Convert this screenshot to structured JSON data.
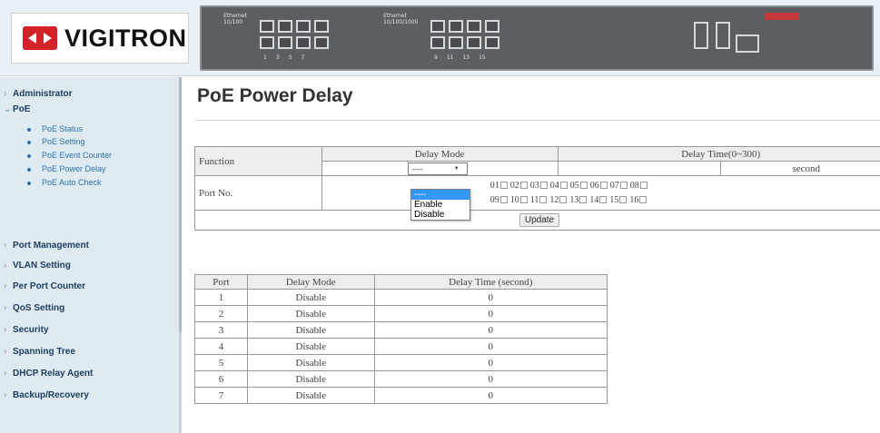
{
  "brand": {
    "logo_text": "VIGITRON"
  },
  "panel": {
    "labels": [
      "Ethernet 10/100",
      "Ethernet 10/100/1000"
    ],
    "port_numbers_left": [
      "1",
      "3",
      "5",
      "7"
    ],
    "port_numbers_right": [
      "9",
      "11",
      "13",
      "15"
    ]
  },
  "sidebar": {
    "items": [
      {
        "label": "Administrator"
      },
      {
        "label": "PoE"
      },
      {
        "label": "Port Management"
      },
      {
        "label": "VLAN Setting"
      },
      {
        "label": "Per Port Counter"
      },
      {
        "label": "QoS Setting"
      },
      {
        "label": "Security"
      },
      {
        "label": "Spanning Tree"
      },
      {
        "label": "DHCP Relay Agent"
      },
      {
        "label": "Backup/Recovery"
      }
    ],
    "poe_subitems": [
      {
        "label": "PoE Status"
      },
      {
        "label": "PoE Setting"
      },
      {
        "label": "PoE Event Counter"
      },
      {
        "label": "PoE Power Delay"
      },
      {
        "label": "PoE Auto Check"
      }
    ]
  },
  "page": {
    "title": "PoE Power Delay"
  },
  "config": {
    "function_label": "Function",
    "delay_mode_header": "Delay Mode",
    "delay_time_header": "Delay Time(0~300)",
    "delay_mode_selected": "----",
    "delay_time_unit": "second",
    "port_no_label": "Port No.",
    "dropdown_options": [
      "----",
      "Enable",
      "Disable"
    ],
    "ports_row1": [
      "01",
      "02",
      "03",
      "04",
      "05",
      "06",
      "07",
      "08"
    ],
    "ports_row2": [
      "09",
      "10",
      "11",
      "12",
      "13",
      "14",
      "15",
      "16"
    ],
    "update_label": "Update"
  },
  "status_table": {
    "headers": [
      "Port",
      "Delay Mode",
      "Delay Time (second)"
    ],
    "rows": [
      {
        "port": "1",
        "mode": "Disable",
        "time": "0"
      },
      {
        "port": "2",
        "mode": "Disable",
        "time": "0"
      },
      {
        "port": "3",
        "mode": "Disable",
        "time": "0"
      },
      {
        "port": "4",
        "mode": "Disable",
        "time": "0"
      },
      {
        "port": "5",
        "mode": "Disable",
        "time": "0"
      },
      {
        "port": "6",
        "mode": "Disable",
        "time": "0"
      },
      {
        "port": "7",
        "mode": "Disable",
        "time": "0"
      }
    ]
  }
}
